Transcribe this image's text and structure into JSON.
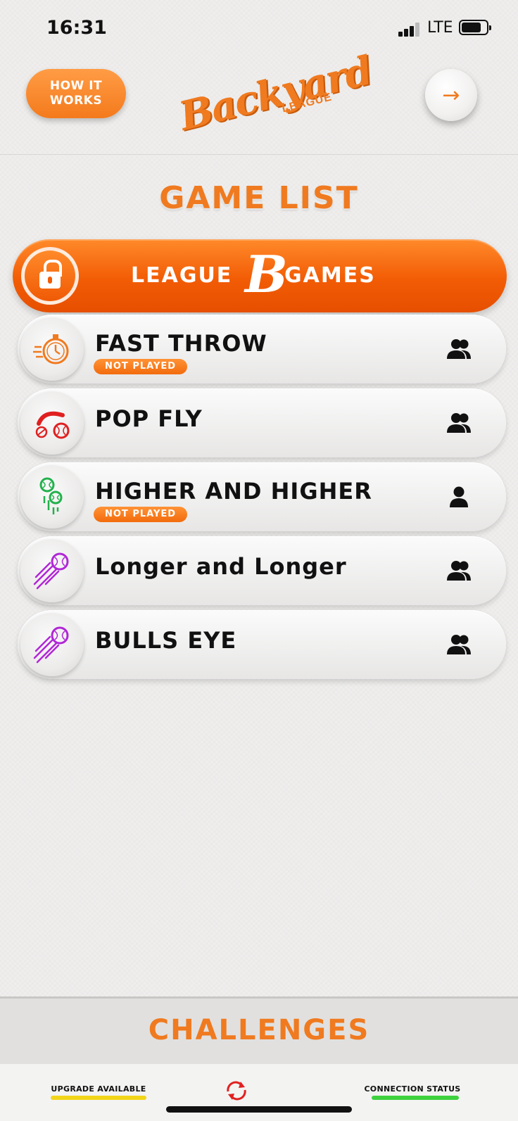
{
  "status_bar": {
    "time": "16:31",
    "network": "LTE"
  },
  "header": {
    "how_it_works": "HOW IT WORKS",
    "logo_main": "Backyard",
    "logo_sub": "LEAGUE",
    "next_arrow": "→"
  },
  "page_title": "GAME LIST",
  "league_banner": {
    "left": "LEAGUE",
    "right": "GAMES",
    "emblem": "B",
    "icon": "lock-icon"
  },
  "games": [
    {
      "name": "FAST THROW",
      "badge": "NOT PLAYED",
      "icon": "stopwatch-icon",
      "players": "group-icon",
      "accent": "#f07a1f"
    },
    {
      "name": "POP FLY",
      "badge": "",
      "icon": "bat-ball-icon",
      "players": "group-icon",
      "accent": "#e02020"
    },
    {
      "name": "HIGHER AND HIGHER",
      "badge": "NOT PLAYED",
      "icon": "rising-balls-icon",
      "players": "single-player-icon",
      "accent": "#22b14c"
    },
    {
      "name": "Longer and Longer",
      "badge": "",
      "icon": "flying-ball-icon",
      "players": "group-icon",
      "accent": "#b027d6"
    },
    {
      "name": "BULLS EYE",
      "badge": "",
      "icon": "flying-ball-icon",
      "players": "group-icon",
      "accent": "#b027d6"
    }
  ],
  "challenges": "CHALLENGES",
  "footer": {
    "upgrade": "UPGRADE AVAILABLE",
    "connection": "CONNECTION STATUS",
    "upgrade_color": "#f2d51a",
    "connection_color": "#3fd23f"
  },
  "colors": {
    "accent": "#f07a1f",
    "banner": "#f25c05"
  }
}
